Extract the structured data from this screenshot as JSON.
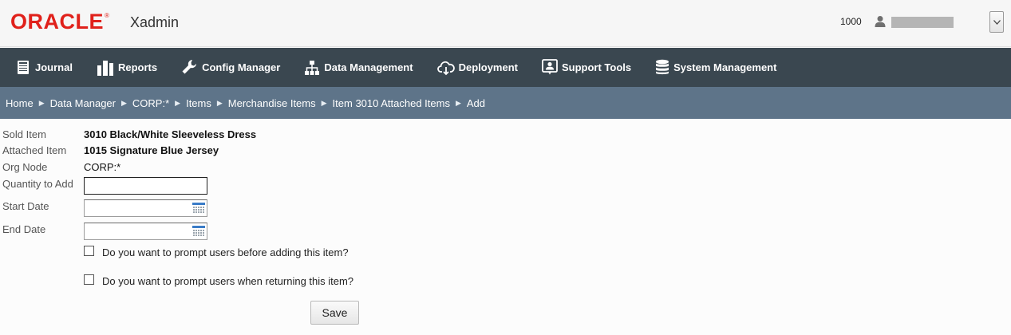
{
  "header": {
    "logo_text": "ORACLE",
    "logo_mark": "®",
    "app_name": "Xadmin",
    "store_number": "1000",
    "user_icon": "person-icon",
    "dropdown_icon": "chevron-down-icon"
  },
  "nav": {
    "items": [
      {
        "label": "Journal",
        "icon": "book-icon"
      },
      {
        "label": "Reports",
        "icon": "bar-chart-icon"
      },
      {
        "label": "Config Manager",
        "icon": "wrench-icon"
      },
      {
        "label": "Data Management",
        "icon": "hierarchy-icon"
      },
      {
        "label": "Deployment",
        "icon": "cloud-download-icon"
      },
      {
        "label": "Support Tools",
        "icon": "support-icon"
      },
      {
        "label": "System Management",
        "icon": "database-icon"
      }
    ]
  },
  "breadcrumb": {
    "items": [
      "Home",
      "Data Manager",
      "CORP:*",
      "Items",
      "Merchandise Items",
      "Item 3010 Attached Items",
      "Add"
    ]
  },
  "form": {
    "sold_item_label": "Sold Item",
    "sold_item_value": "3010 Black/White Sleeveless Dress",
    "attached_item_label": "Attached Item",
    "attached_item_value": "1015 Signature Blue Jersey",
    "org_node_label": "Org Node",
    "org_node_value": "CORP:*",
    "quantity_label": "Quantity to Add",
    "quantity_value": "",
    "start_date_label": "Start Date",
    "start_date_value": "",
    "end_date_label": "End Date",
    "end_date_value": "",
    "prompt_add_label": "Do you want to prompt users before adding this item?",
    "prompt_add_checked": false,
    "prompt_return_label": "Do you want to prompt users when returning this item?",
    "prompt_return_checked": false,
    "save_label": "Save"
  },
  "colors": {
    "brand_red": "#e0211b",
    "nav_bg": "#3a4750",
    "breadcrumb_bg": "#5e7489"
  }
}
